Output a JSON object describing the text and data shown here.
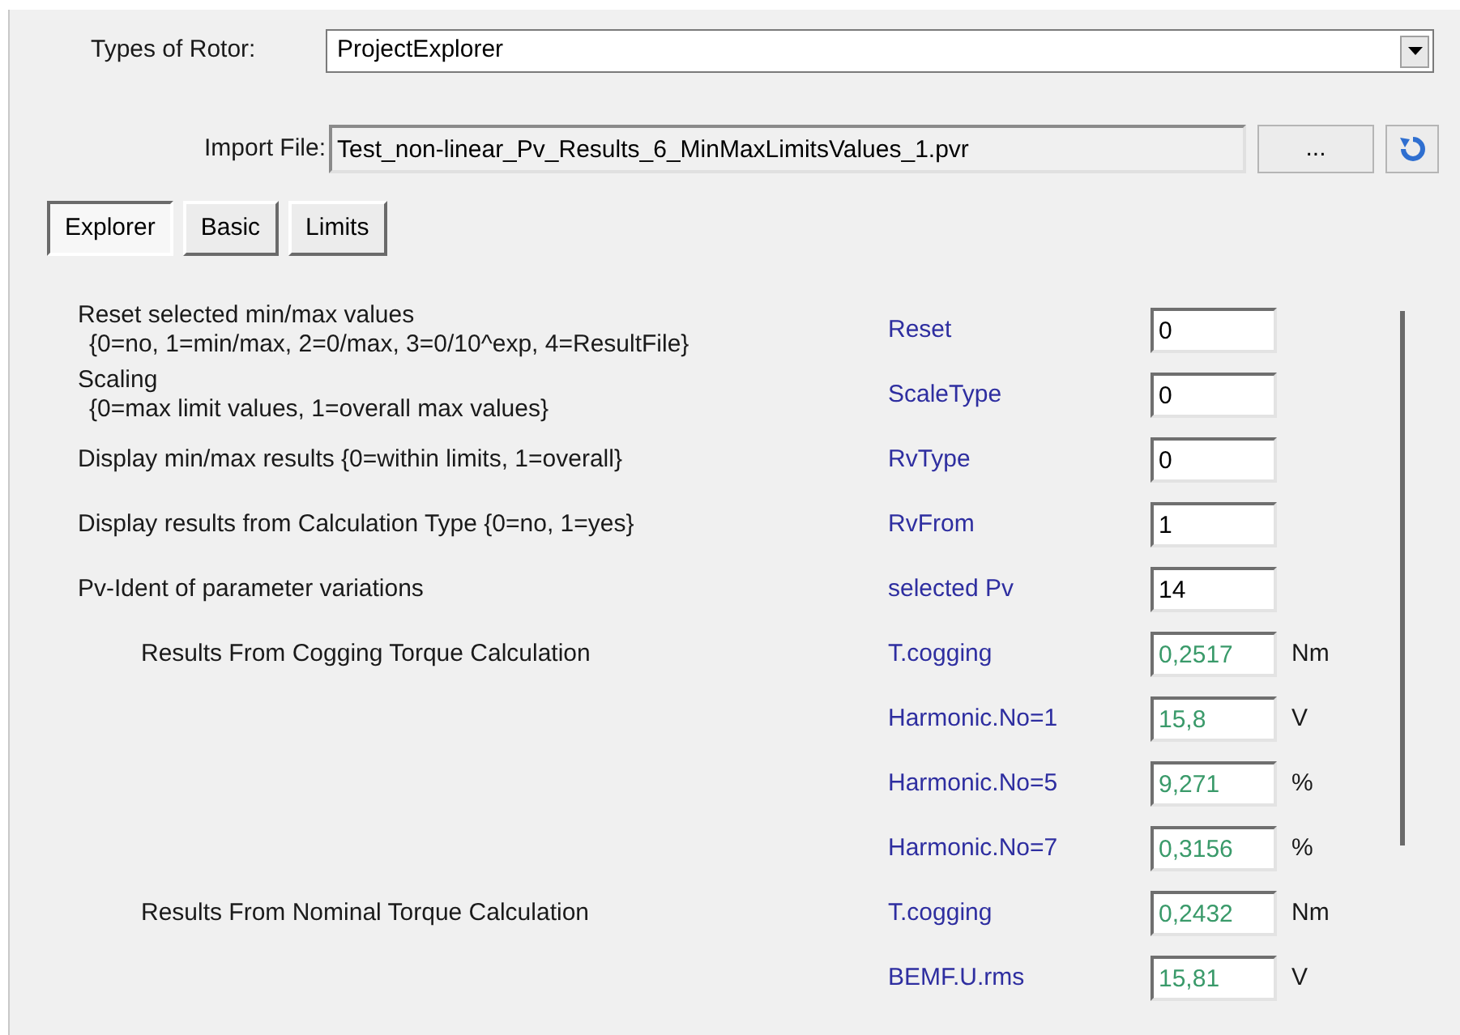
{
  "rotor": {
    "label": "Types of Rotor:",
    "value": "ProjectExplorer"
  },
  "import": {
    "label": "Import File:",
    "value": "Test_non-linear_Pv_Results_6_MinMaxLimitsValues_1.pvr",
    "browse": "..."
  },
  "tabs": [
    {
      "label": "Explorer",
      "selected": true
    },
    {
      "label": "Basic",
      "selected": false
    },
    {
      "label": "Limits",
      "selected": false
    }
  ],
  "rows": [
    {
      "kind": "input",
      "description": "Reset selected min/max values",
      "note": "{0=no, 1=min/max, 2=0/max, 3=0/10^exp, 4=ResultFile}",
      "param": "Reset",
      "value": "0"
    },
    {
      "kind": "input",
      "description": "Scaling",
      "note": "{0=max limit values, 1=overall max values}",
      "param": "ScaleType",
      "value": "0"
    },
    {
      "kind": "input",
      "description": "Display min/max results {0=within limits, 1=overall}",
      "param": "RvType",
      "value": "0"
    },
    {
      "kind": "input",
      "description": "Display results from Calculation Type {0=no, 1=yes}",
      "param": "RvFrom",
      "value": "1"
    },
    {
      "kind": "input",
      "description": "Pv-Ident of parameter variations",
      "param": "selected Pv",
      "value": "14"
    },
    {
      "kind": "result",
      "description": "Results From Cogging Torque Calculation",
      "param": "T.cogging",
      "value": "0,2517",
      "unit": "Nm"
    },
    {
      "kind": "result",
      "param": "Harmonic.No=1",
      "value": "15,8",
      "unit": "V"
    },
    {
      "kind": "result",
      "param": "Harmonic.No=5",
      "value": "9,271",
      "unit": "%"
    },
    {
      "kind": "result",
      "param": "Harmonic.No=7",
      "value": "0,3156",
      "unit": "%"
    },
    {
      "kind": "result",
      "description": "Results From Nominal Torque Calculation",
      "param": "T.cogging",
      "value": "0,2432",
      "unit": "Nm"
    },
    {
      "kind": "result",
      "param": "BEMF.U.rms",
      "value": "15,81",
      "unit": "V"
    }
  ]
}
